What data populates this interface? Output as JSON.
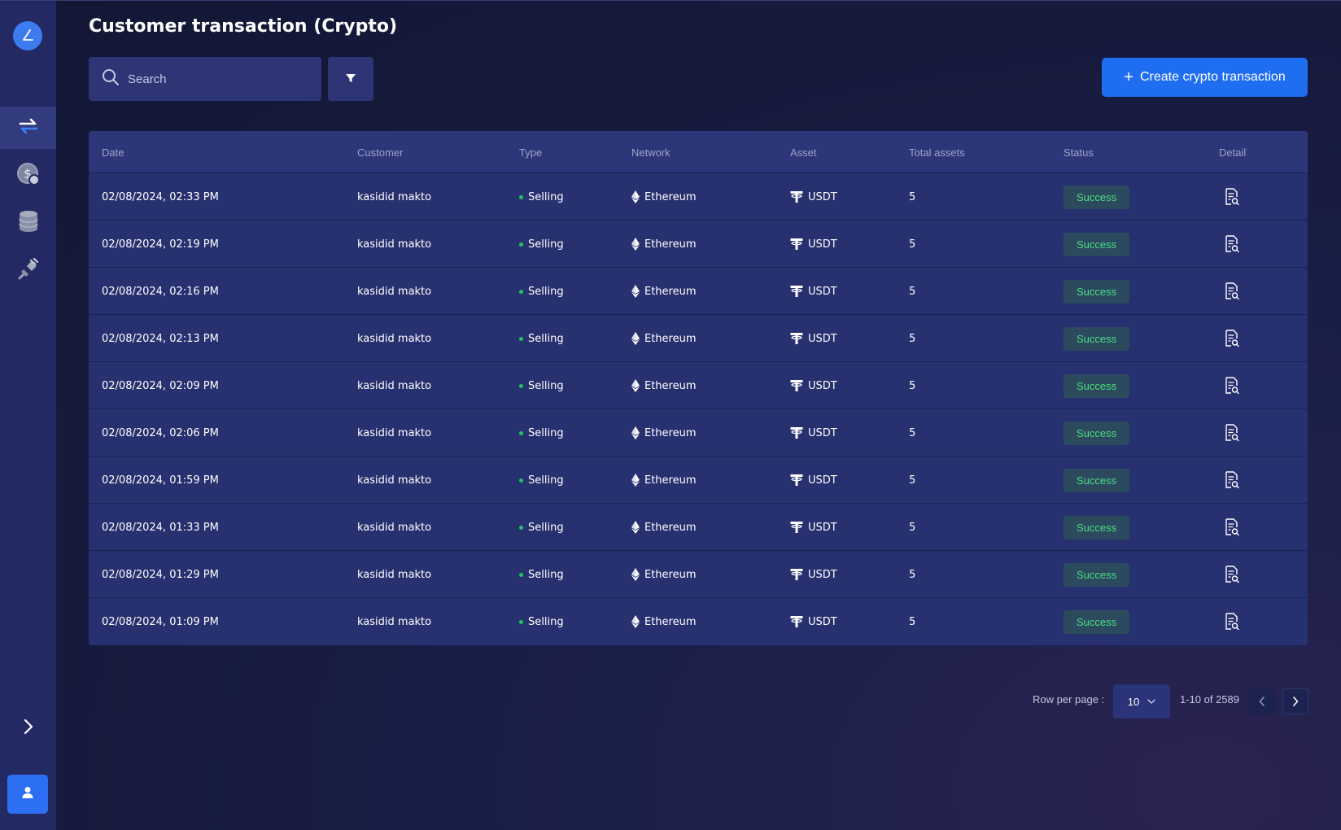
{
  "page": {
    "title": "Customer transaction (Crypto)"
  },
  "search": {
    "placeholder": "Search"
  },
  "actions": {
    "create_label": "Create crypto transaction"
  },
  "table": {
    "headers": [
      "Date",
      "Customer",
      "Type",
      "Network",
      "Asset",
      "Total assets",
      "Status",
      "Detail"
    ],
    "rows": [
      {
        "date": "02/08/2024, 02:33 PM",
        "customer": "kasidid makto",
        "type": "Selling",
        "network": "Ethereum",
        "asset": "USDT",
        "total": "5",
        "status": "Success"
      },
      {
        "date": "02/08/2024, 02:19 PM",
        "customer": "kasidid makto",
        "type": "Selling",
        "network": "Ethereum",
        "asset": "USDT",
        "total": "5",
        "status": "Success"
      },
      {
        "date": "02/08/2024, 02:16 PM",
        "customer": "kasidid makto",
        "type": "Selling",
        "network": "Ethereum",
        "asset": "USDT",
        "total": "5",
        "status": "Success"
      },
      {
        "date": "02/08/2024, 02:13 PM",
        "customer": "kasidid makto",
        "type": "Selling",
        "network": "Ethereum",
        "asset": "USDT",
        "total": "5",
        "status": "Success"
      },
      {
        "date": "02/08/2024, 02:09 PM",
        "customer": "kasidid makto",
        "type": "Selling",
        "network": "Ethereum",
        "asset": "USDT",
        "total": "5",
        "status": "Success"
      },
      {
        "date": "02/08/2024, 02:06 PM",
        "customer": "kasidid makto",
        "type": "Selling",
        "network": "Ethereum",
        "asset": "USDT",
        "total": "5",
        "status": "Success"
      },
      {
        "date": "02/08/2024, 01:59 PM",
        "customer": "kasidid makto",
        "type": "Selling",
        "network": "Ethereum",
        "asset": "USDT",
        "total": "5",
        "status": "Success"
      },
      {
        "date": "02/08/2024, 01:33 PM",
        "customer": "kasidid makto",
        "type": "Selling",
        "network": "Ethereum",
        "asset": "USDT",
        "total": "5",
        "status": "Success"
      },
      {
        "date": "02/08/2024, 01:29 PM",
        "customer": "kasidid makto",
        "type": "Selling",
        "network": "Ethereum",
        "asset": "USDT",
        "total": "5",
        "status": "Success"
      },
      {
        "date": "02/08/2024, 01:09 PM",
        "customer": "kasidid makto",
        "type": "Selling",
        "network": "Ethereum",
        "asset": "USDT",
        "total": "5",
        "status": "Success"
      }
    ]
  },
  "pagination": {
    "rows_label": "Row per page :",
    "rows_value": "10",
    "range": "1-10 of 2589"
  },
  "icons": {
    "logo": "logo-icon",
    "nav": [
      "transfer-icon",
      "dollar-coin-icon",
      "database-icon",
      "plug-icon"
    ],
    "expand": "chevron-right-icon",
    "profile": "user-icon",
    "detail": "document-search-icon",
    "network": "ethereum-icon",
    "asset": "tether-icon"
  },
  "colors": {
    "accent": "#1f6df0",
    "sidebar": "#232a63",
    "success_text": "#4ade80",
    "success_bg": "#2c4a5e",
    "type_dot": "#22c55e"
  }
}
